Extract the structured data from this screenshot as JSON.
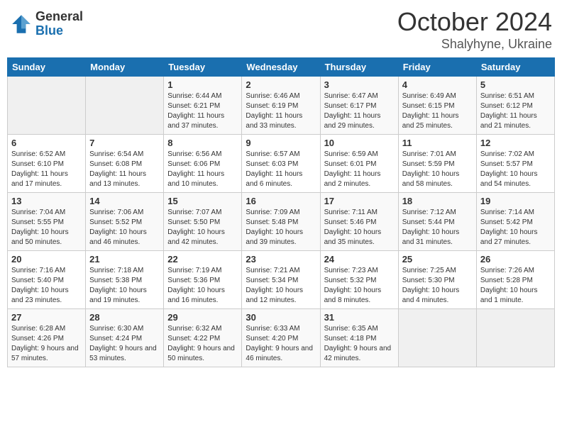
{
  "header": {
    "logo_general": "General",
    "logo_blue": "Blue",
    "month": "October 2024",
    "location": "Shalyhyne, Ukraine"
  },
  "days_of_week": [
    "Sunday",
    "Monday",
    "Tuesday",
    "Wednesday",
    "Thursday",
    "Friday",
    "Saturday"
  ],
  "weeks": [
    [
      {
        "day": "",
        "sunrise": "",
        "sunset": "",
        "daylight": ""
      },
      {
        "day": "",
        "sunrise": "",
        "sunset": "",
        "daylight": ""
      },
      {
        "day": "1",
        "sunrise": "Sunrise: 6:44 AM",
        "sunset": "Sunset: 6:21 PM",
        "daylight": "Daylight: 11 hours and 37 minutes."
      },
      {
        "day": "2",
        "sunrise": "Sunrise: 6:46 AM",
        "sunset": "Sunset: 6:19 PM",
        "daylight": "Daylight: 11 hours and 33 minutes."
      },
      {
        "day": "3",
        "sunrise": "Sunrise: 6:47 AM",
        "sunset": "Sunset: 6:17 PM",
        "daylight": "Daylight: 11 hours and 29 minutes."
      },
      {
        "day": "4",
        "sunrise": "Sunrise: 6:49 AM",
        "sunset": "Sunset: 6:15 PM",
        "daylight": "Daylight: 11 hours and 25 minutes."
      },
      {
        "day": "5",
        "sunrise": "Sunrise: 6:51 AM",
        "sunset": "Sunset: 6:12 PM",
        "daylight": "Daylight: 11 hours and 21 minutes."
      }
    ],
    [
      {
        "day": "6",
        "sunrise": "Sunrise: 6:52 AM",
        "sunset": "Sunset: 6:10 PM",
        "daylight": "Daylight: 11 hours and 17 minutes."
      },
      {
        "day": "7",
        "sunrise": "Sunrise: 6:54 AM",
        "sunset": "Sunset: 6:08 PM",
        "daylight": "Daylight: 11 hours and 13 minutes."
      },
      {
        "day": "8",
        "sunrise": "Sunrise: 6:56 AM",
        "sunset": "Sunset: 6:06 PM",
        "daylight": "Daylight: 11 hours and 10 minutes."
      },
      {
        "day": "9",
        "sunrise": "Sunrise: 6:57 AM",
        "sunset": "Sunset: 6:03 PM",
        "daylight": "Daylight: 11 hours and 6 minutes."
      },
      {
        "day": "10",
        "sunrise": "Sunrise: 6:59 AM",
        "sunset": "Sunset: 6:01 PM",
        "daylight": "Daylight: 11 hours and 2 minutes."
      },
      {
        "day": "11",
        "sunrise": "Sunrise: 7:01 AM",
        "sunset": "Sunset: 5:59 PM",
        "daylight": "Daylight: 10 hours and 58 minutes."
      },
      {
        "day": "12",
        "sunrise": "Sunrise: 7:02 AM",
        "sunset": "Sunset: 5:57 PM",
        "daylight": "Daylight: 10 hours and 54 minutes."
      }
    ],
    [
      {
        "day": "13",
        "sunrise": "Sunrise: 7:04 AM",
        "sunset": "Sunset: 5:55 PM",
        "daylight": "Daylight: 10 hours and 50 minutes."
      },
      {
        "day": "14",
        "sunrise": "Sunrise: 7:06 AM",
        "sunset": "Sunset: 5:52 PM",
        "daylight": "Daylight: 10 hours and 46 minutes."
      },
      {
        "day": "15",
        "sunrise": "Sunrise: 7:07 AM",
        "sunset": "Sunset: 5:50 PM",
        "daylight": "Daylight: 10 hours and 42 minutes."
      },
      {
        "day": "16",
        "sunrise": "Sunrise: 7:09 AM",
        "sunset": "Sunset: 5:48 PM",
        "daylight": "Daylight: 10 hours and 39 minutes."
      },
      {
        "day": "17",
        "sunrise": "Sunrise: 7:11 AM",
        "sunset": "Sunset: 5:46 PM",
        "daylight": "Daylight: 10 hours and 35 minutes."
      },
      {
        "day": "18",
        "sunrise": "Sunrise: 7:12 AM",
        "sunset": "Sunset: 5:44 PM",
        "daylight": "Daylight: 10 hours and 31 minutes."
      },
      {
        "day": "19",
        "sunrise": "Sunrise: 7:14 AM",
        "sunset": "Sunset: 5:42 PM",
        "daylight": "Daylight: 10 hours and 27 minutes."
      }
    ],
    [
      {
        "day": "20",
        "sunrise": "Sunrise: 7:16 AM",
        "sunset": "Sunset: 5:40 PM",
        "daylight": "Daylight: 10 hours and 23 minutes."
      },
      {
        "day": "21",
        "sunrise": "Sunrise: 7:18 AM",
        "sunset": "Sunset: 5:38 PM",
        "daylight": "Daylight: 10 hours and 19 minutes."
      },
      {
        "day": "22",
        "sunrise": "Sunrise: 7:19 AM",
        "sunset": "Sunset: 5:36 PM",
        "daylight": "Daylight: 10 hours and 16 minutes."
      },
      {
        "day": "23",
        "sunrise": "Sunrise: 7:21 AM",
        "sunset": "Sunset: 5:34 PM",
        "daylight": "Daylight: 10 hours and 12 minutes."
      },
      {
        "day": "24",
        "sunrise": "Sunrise: 7:23 AM",
        "sunset": "Sunset: 5:32 PM",
        "daylight": "Daylight: 10 hours and 8 minutes."
      },
      {
        "day": "25",
        "sunrise": "Sunrise: 7:25 AM",
        "sunset": "Sunset: 5:30 PM",
        "daylight": "Daylight: 10 hours and 4 minutes."
      },
      {
        "day": "26",
        "sunrise": "Sunrise: 7:26 AM",
        "sunset": "Sunset: 5:28 PM",
        "daylight": "Daylight: 10 hours and 1 minute."
      }
    ],
    [
      {
        "day": "27",
        "sunrise": "Sunrise: 6:28 AM",
        "sunset": "Sunset: 4:26 PM",
        "daylight": "Daylight: 9 hours and 57 minutes."
      },
      {
        "day": "28",
        "sunrise": "Sunrise: 6:30 AM",
        "sunset": "Sunset: 4:24 PM",
        "daylight": "Daylight: 9 hours and 53 minutes."
      },
      {
        "day": "29",
        "sunrise": "Sunrise: 6:32 AM",
        "sunset": "Sunset: 4:22 PM",
        "daylight": "Daylight: 9 hours and 50 minutes."
      },
      {
        "day": "30",
        "sunrise": "Sunrise: 6:33 AM",
        "sunset": "Sunset: 4:20 PM",
        "daylight": "Daylight: 9 hours and 46 minutes."
      },
      {
        "day": "31",
        "sunrise": "Sunrise: 6:35 AM",
        "sunset": "Sunset: 4:18 PM",
        "daylight": "Daylight: 9 hours and 42 minutes."
      },
      {
        "day": "",
        "sunrise": "",
        "sunset": "",
        "daylight": ""
      },
      {
        "day": "",
        "sunrise": "",
        "sunset": "",
        "daylight": ""
      }
    ]
  ]
}
